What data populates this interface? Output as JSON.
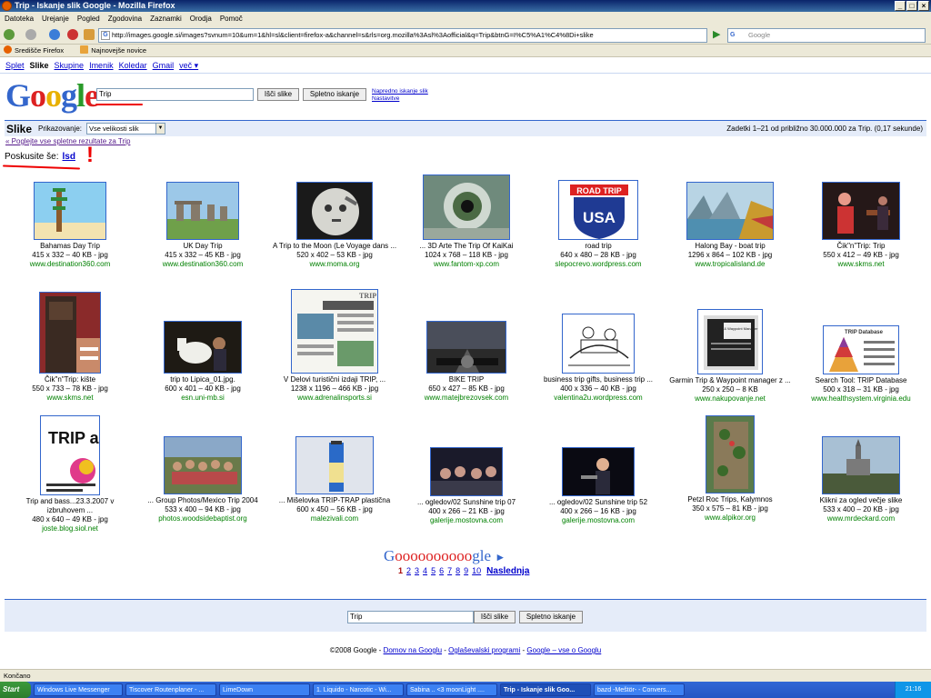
{
  "window": {
    "title": "Trip - Iskanje slik Google - Mozilla Firefox",
    "buttons": [
      "_",
      "□",
      "×"
    ]
  },
  "menu": [
    "Datoteka",
    "Urejanje",
    "Pogled",
    "Zgodovina",
    "Zaznamki",
    "Orodja",
    "Pomoč"
  ],
  "nav": {
    "url": "http://images.google.si/images?svnum=10&um=1&hl=sl&client=firefox-a&channel=s&rls=org.mozilla%3Asl%3Aofficial&q=Trip&btnG=I%C5%A1%C4%8Di+slike",
    "search_placeholder": "Google",
    "search_icon": "G"
  },
  "bookmarks": [
    "Središče Firefox",
    "Najnovejše novice"
  ],
  "gbar": {
    "links": [
      "Splet",
      "Slike",
      "Skupine",
      "Imenik",
      "Koledar",
      "Gmail",
      "več ▾"
    ]
  },
  "search": {
    "logo": "Google",
    "query": "Trip",
    "btn_images": "Išči slike",
    "btn_web": "Spletno iskanje",
    "advanced": "Napredno iskanje slik",
    "settings": "Nastavitve"
  },
  "resbar": {
    "title": "Slike",
    "display_label": "Prikazovanje:",
    "size_value": "Vse velikosti slik",
    "stats": "Zadetki 1–21 od približno 30.000.000 za Trip. (0,17 sekunde)"
  },
  "see_all": "« Poglejte vse spletne rezultate za Trip",
  "try_also": {
    "label": "Poskusite še:",
    "link": "lsd"
  },
  "results": [
    {
      "caption": "Bahamas Day Trip",
      "size": "415 x 332 – 40 KB - jpg",
      "host": "www.destination360.com"
    },
    {
      "caption": "UK Day Trip",
      "size": "415 x 332 – 45 KB - jpg",
      "host": "www.destination360.com"
    },
    {
      "caption": "A Trip to the Moon (Le Voyage dans ...",
      "size": "520 x 402 – 53 KB - jpg",
      "host": "www.moma.org"
    },
    {
      "caption": "... 3D Arte The Trip Of KaiKai",
      "size": "1024 x 768 – 118 KB - jpg",
      "host": "www.fantom-xp.com"
    },
    {
      "caption": "road trip",
      "size": "640 x 480 – 28 KB - jpg",
      "host": "slepocrevo.wordpress.com"
    },
    {
      "caption": "Halong Bay - boat trip",
      "size": "1296 x 864 – 102 KB - jpg",
      "host": "www.tropicalisland.de"
    },
    {
      "caption": "Čik\"n\"Trip: Trip",
      "size": "550 x 412 – 49 KB - jpg",
      "host": "www.skms.net"
    },
    {
      "caption": "Čik\"n\"Trip: kište",
      "size": "550 x 733 – 78 KB - jpg",
      "host": "www.skms.net"
    },
    {
      "caption": "trip to Lipica_01.jpg.",
      "size": "600 x 401 – 40 KB - jpg",
      "host": "esn.uni-mb.si"
    },
    {
      "caption": "V Delovi turistični izdaji TRIP, ...",
      "size": "1238 x 1196 – 466 KB - jpg",
      "host": "www.adrenalinsports.si"
    },
    {
      "caption": "BIKE TRIP",
      "size": "650 x 427 – 85 KB - jpg",
      "host": "www.matejbrezovsek.com"
    },
    {
      "caption": "business trip gifts, business trip ...",
      "size": "400 x 336 – 40 KB - jpg",
      "host": "valentina2u.wordpress.com"
    },
    {
      "caption": "Garmin Trip & Waypoint manager z ...",
      "size": "250 x 250 – 8 KB",
      "host": "www.nakupovanje.net"
    },
    {
      "caption": "Search Tool: TRIP Database",
      "size": "500 x 318 – 31 KB - jpg",
      "host": "www.healthsystem.virginia.edu"
    },
    {
      "caption": "Trip and bass...23.3.2007 v izbruhovem ...",
      "size": "480 x 640 – 49 KB - jpg",
      "host": "joste.blog.siol.net"
    },
    {
      "caption": "... Group Photos/Mexico Trip 2004",
      "size": "533 x 400 – 94 KB - jpg",
      "host": "photos.woodsidebaptist.org"
    },
    {
      "caption": "... Mišelovka TRIP-TRAP plastična",
      "size": "600 x 450 – 56 KB - jpg",
      "host": "malezivali.com"
    },
    {
      "caption": "... ogledov/02 Sunshine trip 07",
      "size": "400 x 266 – 21 KB - jpg",
      "host": "galerije.mostovna.com"
    },
    {
      "caption": "... ogledov/02 Sunshine trip 52",
      "size": "400 x 266 – 16 KB - jpg",
      "host": "galerije.mostovna.com"
    },
    {
      "caption": "Petzl Roc Trips, Kalymnos",
      "size": "350 x 575 – 81 KB - jpg",
      "host": "www.alpikor.org"
    },
    {
      "caption": "Klikni za ogled večje slike",
      "size": "533 x 400 – 20 KB - jpg",
      "host": "www.mrdeckard.com"
    }
  ],
  "thumb_texts": {
    "roadtrip": "ROAD TRIP",
    "usa": "USA",
    "tripbass": "TRIP and BASS",
    "mag": "TRIP",
    "db": "TRIP Database",
    "garmin": "Trip & Waypoint Manager"
  },
  "pager": {
    "logo_g": "G",
    "logo_os": "oooooooooo",
    "logo_gle": "gle",
    "logo_arrow": "►",
    "pages": [
      "1",
      "2",
      "3",
      "4",
      "5",
      "6",
      "7",
      "8",
      "9",
      "10"
    ],
    "next": "Naslednja"
  },
  "footer": {
    "query": "Trip",
    "btn_images": "Išči slike",
    "btn_web": "Spletno iskanje",
    "copyright": "©2008 Google -",
    "links": [
      "Domov na Googlu",
      "Oglaševalski programi",
      "Google – vse o Googlu"
    ]
  },
  "status": "Končano",
  "taskbar": {
    "start": "Start",
    "tasks": [
      "Windows Live Messenger",
      "Tiscover Routenplaner - ...",
      "LimeDown",
      "1. Liquido - Narcotic - Wi...",
      "Sabina .. <3 moonLight ....",
      "Trip - Iskanje slik Goo...",
      "bazd -Meštör- - Convers..."
    ],
    "clock": "21:16"
  }
}
